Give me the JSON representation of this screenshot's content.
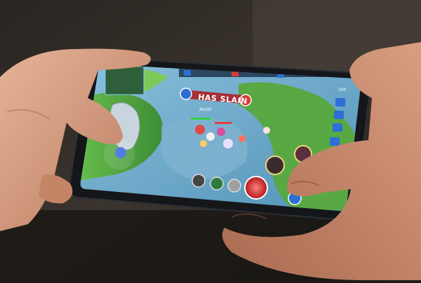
{
  "scene": {
    "description_label": "hands-holding-phone",
    "game": {
      "kill_banner": "HAS SLAIN",
      "player_name_tag": "Assist",
      "score_display": "500"
    }
  },
  "colors": {
    "background_wall": "#3a342f",
    "phone_body": "#16181c",
    "map_water": "#6fa8c8",
    "map_grass": "#5bb04a",
    "hud_blue": "#2c6fd6",
    "hud_red": "#d63a3a",
    "skin": "#d9a184"
  }
}
